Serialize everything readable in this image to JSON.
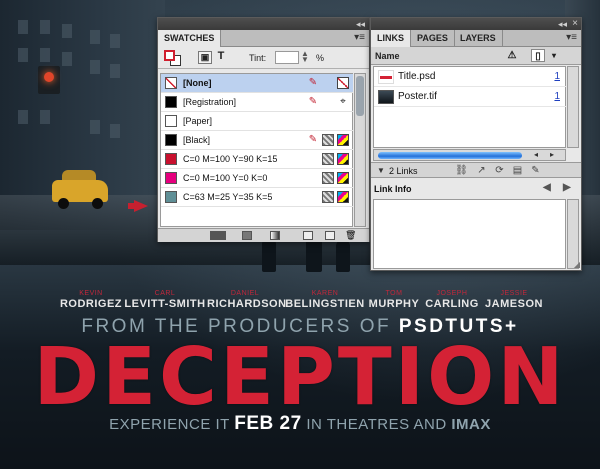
{
  "swatches_panel": {
    "tab_label": "SWATCHES",
    "tint_label": "Tint:",
    "tint_value": "",
    "tint_unit": "%",
    "text_mode_label": "T",
    "swatches": [
      {
        "name": "[None]",
        "color": "#ffffff",
        "selected": true
      },
      {
        "name": "[Registration]",
        "color": "#000000",
        "selected": false
      },
      {
        "name": "[Paper]",
        "color": "#ffffff",
        "selected": false
      },
      {
        "name": "[Black]",
        "color": "#000000",
        "selected": false
      },
      {
        "name": "C=0 M=100 Y=90 K=15",
        "color": "#c8102e",
        "selected": false
      },
      {
        "name": "C=0 M=100 Y=0 K=0",
        "color": "#e6007e",
        "selected": false
      },
      {
        "name": "C=63 M=25 Y=35 K=5",
        "color": "#5f8f96",
        "selected": false
      }
    ]
  },
  "links_panel": {
    "tabs": [
      "LINKS",
      "PAGES",
      "LAYERS"
    ],
    "active_tab": "LINKS",
    "column_name": "Name",
    "links": [
      {
        "name": "Title.psd",
        "page": "1"
      },
      {
        "name": "Poster.tif",
        "page": "1"
      }
    ],
    "status_count": "2 Links",
    "link_info_label": "Link Info"
  },
  "poster": {
    "cast": [
      {
        "first": "KEVIN",
        "last": "RODRIGEZ"
      },
      {
        "first": "CARL",
        "last": "LEVITT-SMITH"
      },
      {
        "first": "DANIEL",
        "last": "RICHARDSON"
      },
      {
        "first": "KAREN",
        "last": "BELINGSTIEN"
      },
      {
        "first": "TOM",
        "last": "MURPHY"
      },
      {
        "first": "JOSEPH",
        "last": "CARLING"
      },
      {
        "first": "JESSIE",
        "last": "JAMESON"
      }
    ],
    "producers_prefix": "FROM THE PRODUCERS OF",
    "producers_brand": "PSDTUTS+",
    "title": "DECEPTION",
    "tagline_prefix": "EXPERIENCE IT",
    "tagline_date": "FEB 27",
    "tagline_middle": "IN THEATRES AND",
    "tagline_brand": "IMAX"
  },
  "colors": {
    "title_red": "#d42235",
    "selection_blue": "#bcd1ef",
    "link_blue": "#1f3fbf"
  }
}
